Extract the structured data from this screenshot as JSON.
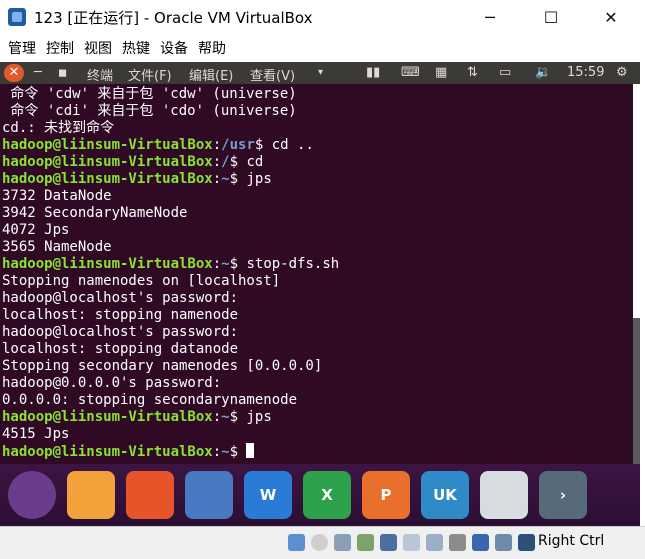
{
  "window": {
    "title": "123 [正在运行] - Oracle VM VirtualBox",
    "minimize": "─",
    "maximize": "☐",
    "close": "✕"
  },
  "vbox_menu": [
    "管理",
    "控制",
    "视图",
    "热键",
    "设备",
    "帮助"
  ],
  "panel": {
    "close": "✕",
    "minimize": "─",
    "maximize": "◼",
    "menus": [
      "终端",
      "文件(F)",
      "编辑(E)",
      "查看(V)"
    ],
    "clock": "15:59"
  },
  "terminal": {
    "lines": [
      {
        "t": "plain",
        "text": " 命令 'cdw' 来自于包 'cdw' (universe)"
      },
      {
        "t": "plain",
        "text": " 命令 'cdi' 来自于包 'cdo' (universe)"
      },
      {
        "t": "plain",
        "text": "cd.: 未找到命令"
      },
      {
        "t": "prompt",
        "user": "hadoop@liinsum-VirtualBox",
        "path": "/usr",
        "cmd": " cd .."
      },
      {
        "t": "prompt",
        "user": "hadoop@liinsum-VirtualBox",
        "path": "/",
        "cmd": " cd"
      },
      {
        "t": "prompt",
        "user": "hadoop@liinsum-VirtualBox",
        "path": "~",
        "cmd": " jps"
      },
      {
        "t": "plain",
        "text": "3732 DataNode"
      },
      {
        "t": "plain",
        "text": "3942 SecondaryNameNode"
      },
      {
        "t": "plain",
        "text": "4072 Jps"
      },
      {
        "t": "plain",
        "text": "3565 NameNode"
      },
      {
        "t": "prompt",
        "user": "hadoop@liinsum-VirtualBox",
        "path": "~",
        "cmd": " stop-dfs.sh"
      },
      {
        "t": "plain",
        "text": "Stopping namenodes on [localhost]"
      },
      {
        "t": "plain",
        "text": "hadoop@localhost's password:"
      },
      {
        "t": "plain",
        "text": "localhost: stopping namenode"
      },
      {
        "t": "plain",
        "text": "hadoop@localhost's password:"
      },
      {
        "t": "plain",
        "text": "localhost: stopping datanode"
      },
      {
        "t": "plain",
        "text": "Stopping secondary namenodes [0.0.0.0]"
      },
      {
        "t": "plain",
        "text": "hadoop@0.0.0.0's password:"
      },
      {
        "t": "plain",
        "text": "0.0.0.0: stopping secondarynamenode"
      },
      {
        "t": "prompt",
        "user": "hadoop@liinsum-VirtualBox",
        "path": "~",
        "cmd": " jps"
      },
      {
        "t": "plain",
        "text": "4515 Jps"
      },
      {
        "t": "prompt",
        "user": "hadoop@liinsum-VirtualBox",
        "path": "~",
        "cmd": " ",
        "cursor": true
      }
    ]
  },
  "launcher": [
    {
      "name": "ubuntu-dash-icon",
      "label": "",
      "color": "#6a3c8c"
    },
    {
      "name": "files-icon",
      "label": "",
      "color": "#f2a23a"
    },
    {
      "name": "firefox-icon",
      "label": "",
      "color": "#e8542a"
    },
    {
      "name": "chromium-icon",
      "label": "",
      "color": "#4a79c4"
    },
    {
      "name": "wps-writer-icon",
      "label": "W",
      "color": "#2a7bd6"
    },
    {
      "name": "wps-spreadsheet-icon",
      "label": "X",
      "color": "#2da14b"
    },
    {
      "name": "wps-presentation-icon",
      "label": "P",
      "color": "#e8702c"
    },
    {
      "name": "software-center-icon",
      "label": "UK",
      "color": "#2e8bc8"
    },
    {
      "name": "update-manager-icon",
      "label": "",
      "color": "#d7dce0"
    },
    {
      "name": "more-apps-icon",
      "label": "›",
      "color": "#566a7a"
    }
  ],
  "statusbar": {
    "host_key": "Right Ctrl"
  }
}
